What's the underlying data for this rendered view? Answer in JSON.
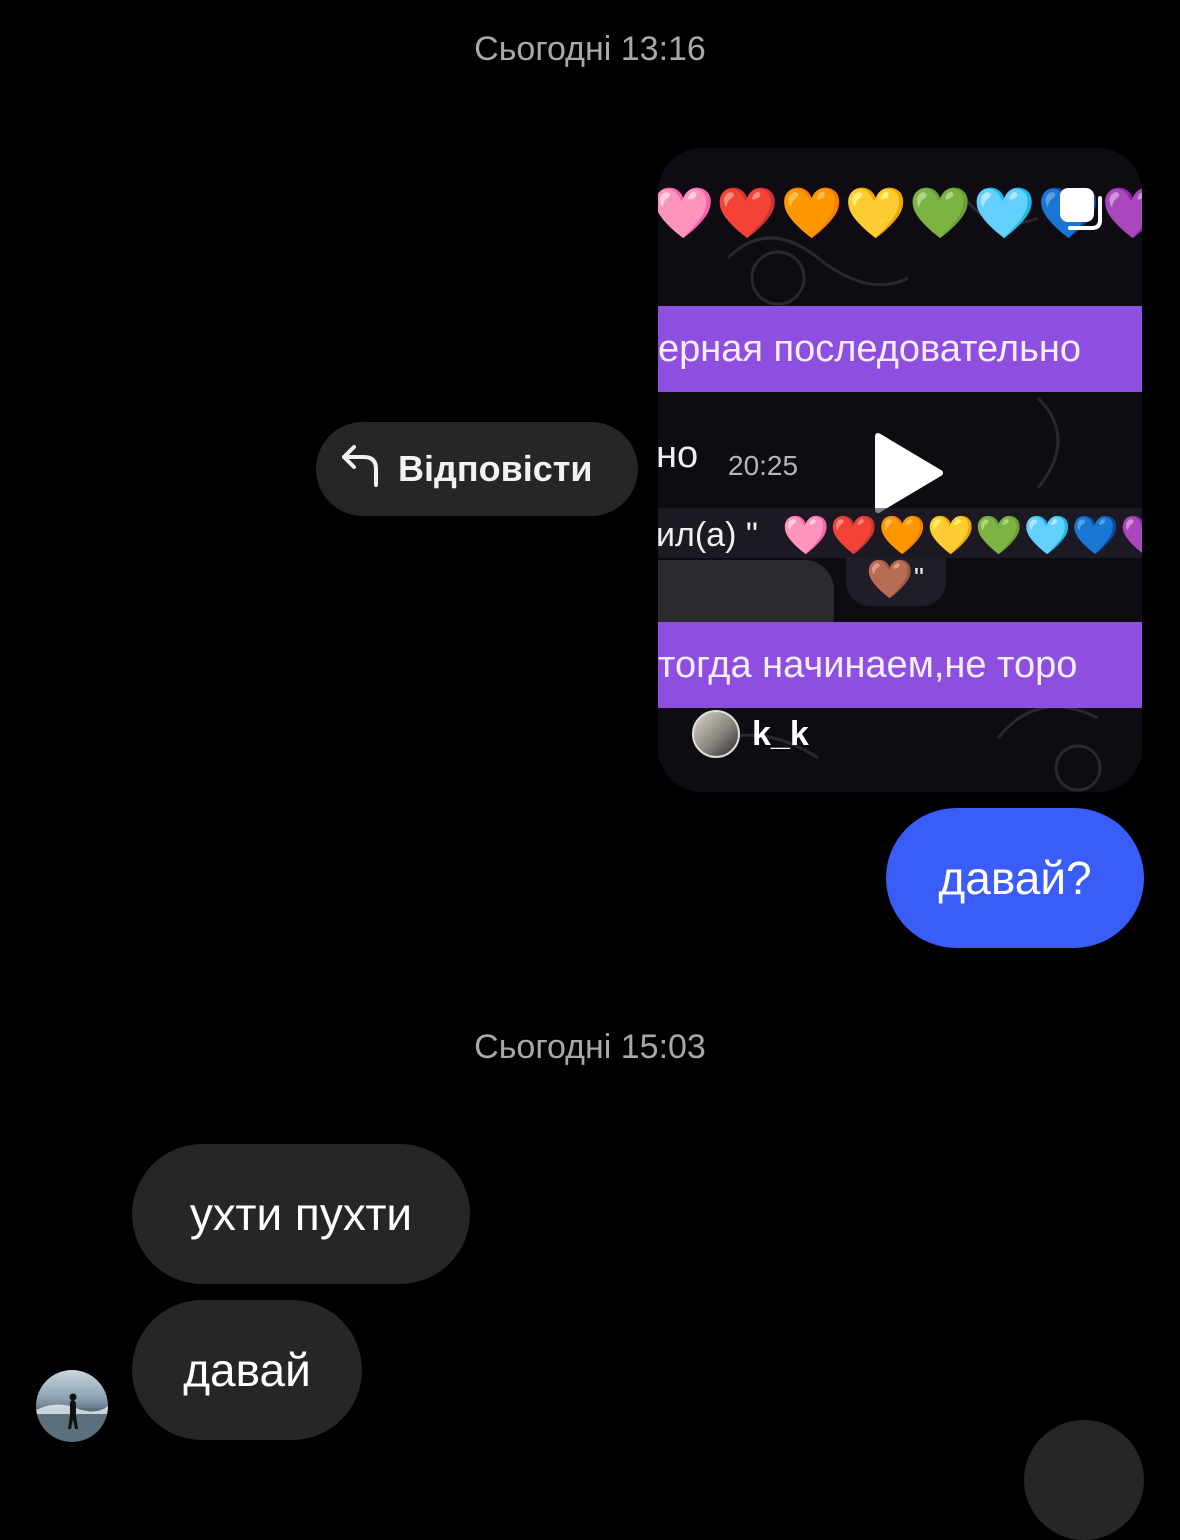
{
  "timestamps": {
    "first": "Сьогодні 13:16",
    "second": "Сьогодні 15:03"
  },
  "reply_action": {
    "label": "Відповісти",
    "icon": "reply-arrow-icon"
  },
  "shared_reel": {
    "top_hearts": "🩷❤️🧡💛💚🩵💙💜",
    "caption_line1": "ерная последовательно",
    "chat_snippet": "но",
    "chat_time": "20:25",
    "line3_prefix": "ил(а) \"",
    "line3_hearts": "🩷❤️🧡💛💚🩵💙💜",
    "brown_heart": "🤎",
    "brown_quote": "\"",
    "caption_line2": "тогда начинаем,не торо",
    "author": "k_k",
    "icons": [
      "play-icon",
      "multi-media-icon"
    ]
  },
  "messages": {
    "sent": [
      {
        "text": "давай?"
      }
    ],
    "received": [
      {
        "text": "ухти пухти"
      },
      {
        "text": "давай"
      }
    ]
  },
  "colors": {
    "background": "#000000",
    "sent_bubble": "#3a5cf7",
    "received_bubble": "#262626",
    "timestamp": "#a8a8a8",
    "reel_bar": "#8e4fe0"
  }
}
